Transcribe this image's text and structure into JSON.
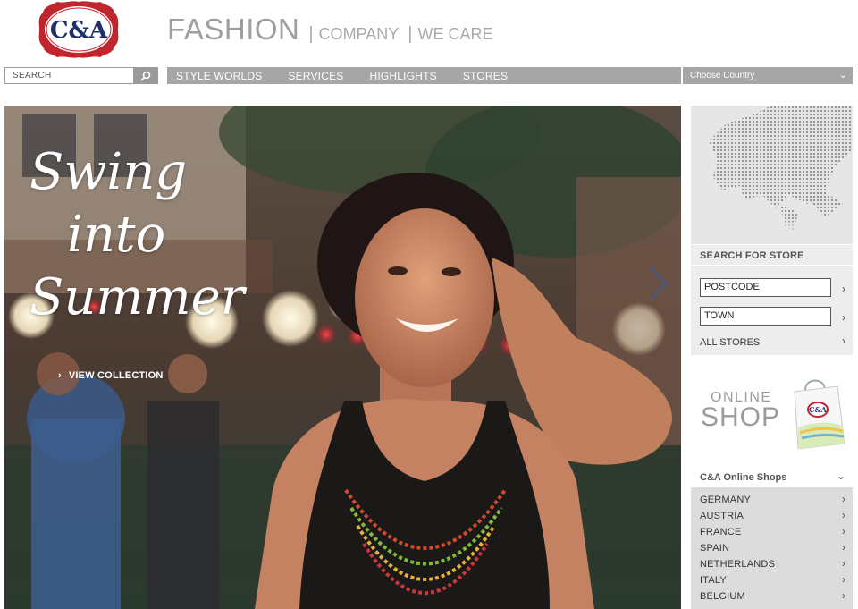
{
  "brand": {
    "logo_text": "C&A",
    "logo_color": "#c0262e"
  },
  "topnav": {
    "main": "FASHION",
    "items": [
      "COMPANY",
      "WE CARE"
    ]
  },
  "search": {
    "placeholder": "SEARCH"
  },
  "navbar": {
    "items": [
      "STYLE WORLDS",
      "SERVICES",
      "HIGHLIGHTS",
      "STORES"
    ]
  },
  "country": {
    "selected": "Choose Country"
  },
  "hero": {
    "slogan": [
      "Swing",
      "into",
      "Summer"
    ],
    "cta": "VIEW COLLECTION"
  },
  "store_search": {
    "title": "SEARCH FOR STORE",
    "postcode_placeholder": "POSTCODE",
    "town_placeholder": "TOWN",
    "all_stores": "ALL STORES"
  },
  "online_shop": {
    "line1": "ONLINE",
    "line2": "SHOP"
  },
  "online_shops": {
    "title": "C&A Online Shops",
    "countries": [
      "GERMANY",
      "AUSTRIA",
      "FRANCE",
      "SPAIN",
      "NETHERLANDS",
      "ITALY",
      "BELGIUM"
    ]
  },
  "icons": [
    "search-icon",
    "chevron-down-icon",
    "chevron-right-icon",
    "europe-map",
    "shopping-bag-icon"
  ]
}
